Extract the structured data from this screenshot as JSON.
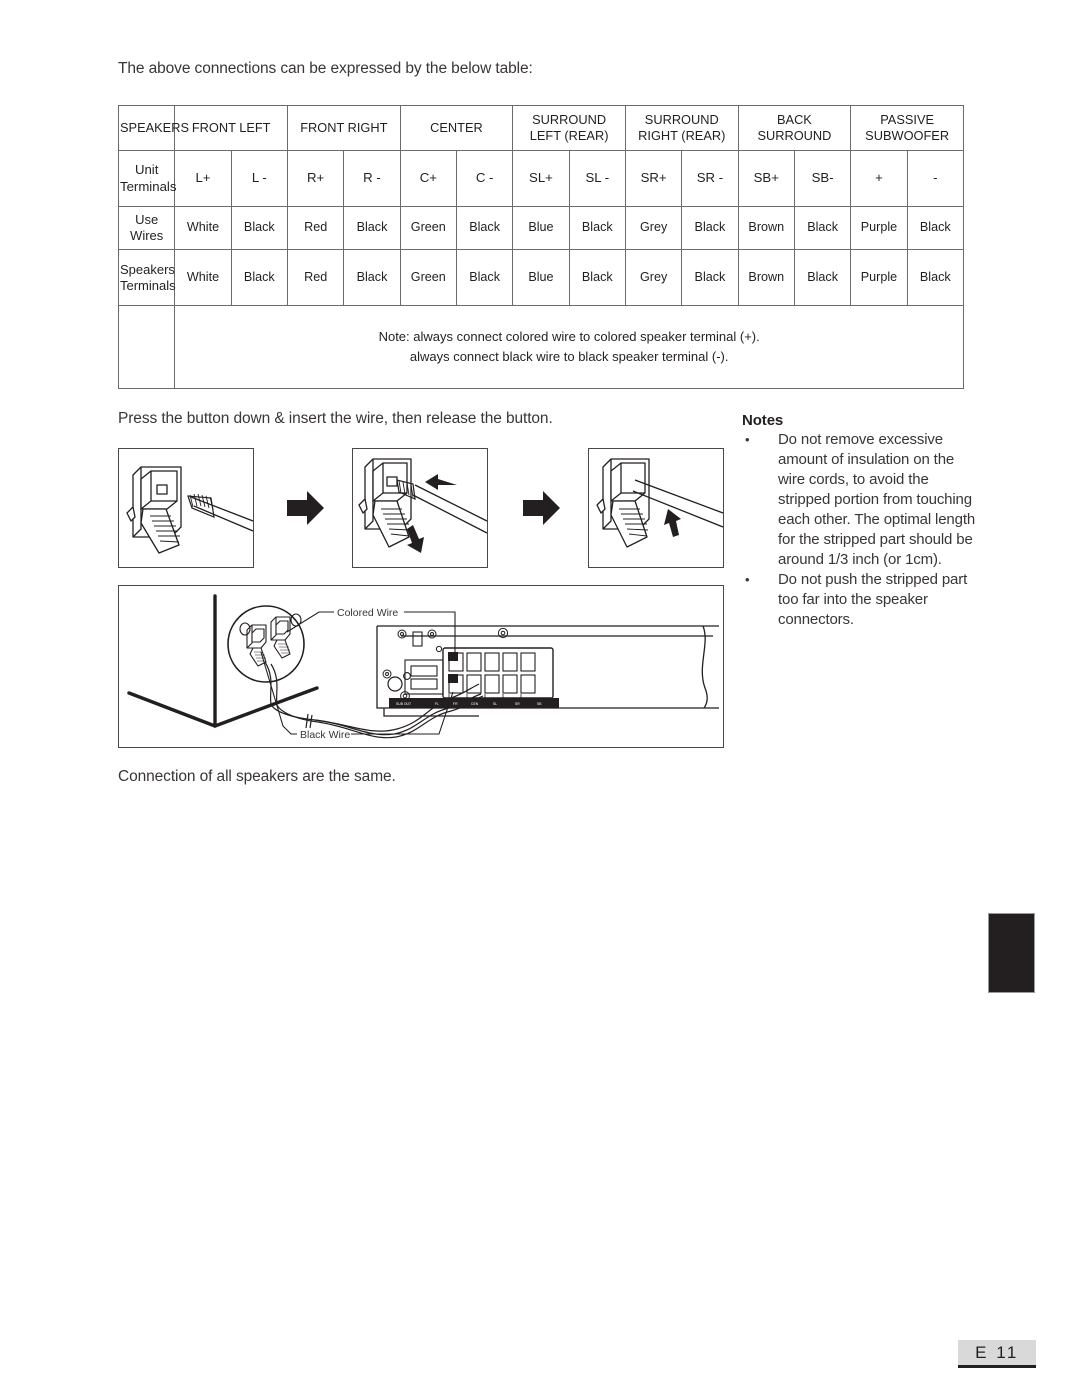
{
  "document": {
    "intro_text": "The above connections can be expressed by the below table:",
    "press_instruction": "Press the button down & insert the wire, then release the button.",
    "closing_text": "Connection of all speakers are the same.",
    "page_number": "E 11"
  },
  "table": {
    "header": [
      {
        "label": "SPEAKERS",
        "colspan": 1
      },
      {
        "label": "FRONT LEFT",
        "colspan": 2
      },
      {
        "label": "FRONT RIGHT",
        "colspan": 2
      },
      {
        "label": "CENTER",
        "colspan": 2
      },
      {
        "label": "SURROUND LEFT (REAR)",
        "colspan": 2
      },
      {
        "label": "SURROUND RIGHT (REAR)",
        "colspan": 2
      },
      {
        "label": "BACK SURROUND",
        "colspan": 2
      },
      {
        "label": "PASSIVE SUBWOOFER",
        "colspan": 2
      }
    ],
    "header_lines": {
      "speakers": "SPEAKERS",
      "front_left": "FRONT LEFT",
      "front_right": "FRONT RIGHT",
      "center": "CENTER",
      "surround_left_1": "SURROUND",
      "surround_left_2": "LEFT (REAR)",
      "surround_right_1": "SURROUND",
      "surround_right_2": "RIGHT (REAR)",
      "back_surround_1": "BACK",
      "back_surround_2": "SURROUND",
      "passive_sub_1": "PASSIVE",
      "passive_sub_2": "SUBWOOFER"
    },
    "rows": [
      {
        "label_line1": "Unit",
        "label_line2": "Terminals",
        "cells": [
          "L+",
          "L -",
          "R+",
          "R -",
          "C+",
          "C -",
          "SL+",
          "SL -",
          "SR+",
          "SR -",
          "SB+",
          "SB-",
          "+",
          "-"
        ]
      },
      {
        "label_line1": "Use Wires",
        "label_line2": "",
        "cells": [
          "White",
          "Black",
          "Red",
          "Black",
          "Green",
          "Black",
          "Blue",
          "Black",
          "Grey",
          "Black",
          "Brown",
          "Black",
          "Purple",
          "Black"
        ]
      },
      {
        "label_line1": "Speakers",
        "label_line2": "Terminals",
        "cells": [
          "White",
          "Black",
          "Red",
          "Black",
          "Green",
          "Black",
          "Blue",
          "Black",
          "Grey",
          "Black",
          "Brown",
          "Black",
          "Purple",
          "Black"
        ]
      }
    ],
    "note_line1": "Note: always connect colored wire to colored speaker terminal (+).",
    "note_line2": "always connect black wire to black speaker terminal (-)."
  },
  "notes": {
    "title": "Notes",
    "items": [
      "Do not remove excessive amount of insulation on the wire cords, to avoid the stripped portion from touching each other. The optimal length for the stripped part should be around 1/3 inch (or 1cm).",
      "Do not push the stripped part too far into the speaker connectors."
    ],
    "bullet": "•"
  },
  "diagram": {
    "colored_wire_label": "Colored Wire",
    "black_wire_label": "Black Wire"
  },
  "colors": {
    "ink": "#231f20",
    "line": "#4c4749",
    "table_border": "#6d6a6b",
    "text": "#3a3537",
    "footer_bg": "#d9d9d9"
  }
}
